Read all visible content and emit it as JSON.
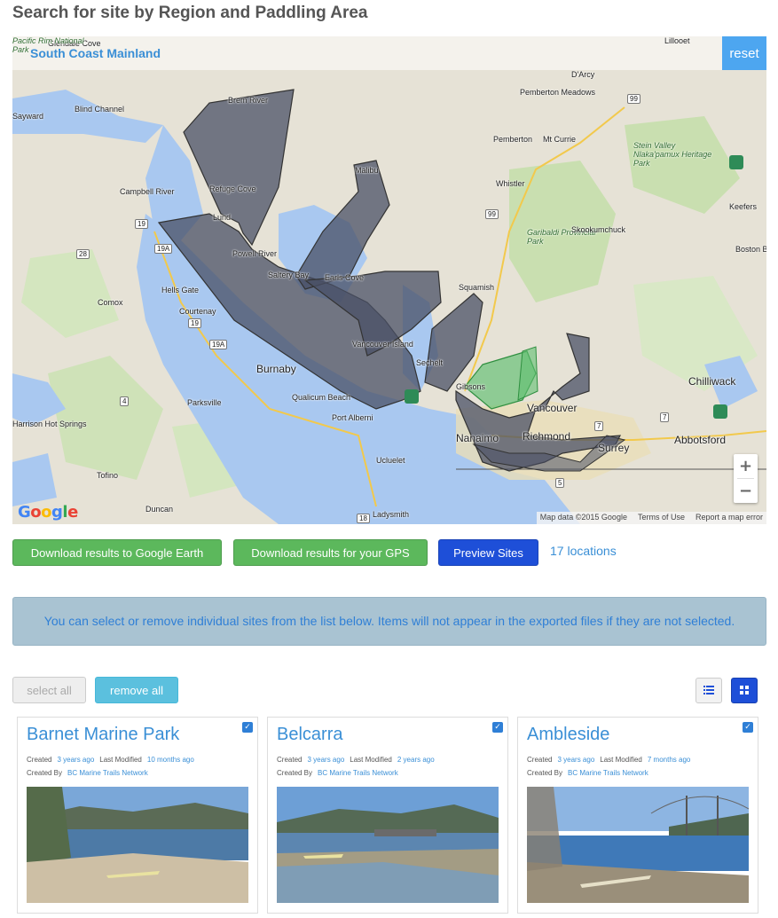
{
  "page": {
    "title": "Search for site by Region and Paddling Area"
  },
  "map": {
    "region_label": "South Coast Mainland",
    "reset_label": "reset",
    "zoom_in": "+",
    "zoom_out": "−",
    "attribution": "Map data ©2015 Google",
    "terms": "Terms of Use",
    "report": "Report a map error",
    "logo": "Google",
    "place_labels": [
      "Glendale Cove",
      "Lillooet",
      "D'Arcy",
      "Brem River",
      "Blind Channel",
      "Sayward",
      "Pemberton Meadows",
      "Pemberton",
      "Mt Currie",
      "Stein Valley Nlaka'pamux Heritage Park",
      "Malibu",
      "Refuge Cove",
      "Campbell River",
      "Whistler",
      "Keefers",
      "Lund",
      "Garibaldi Provincial Park",
      "Skookumchuck",
      "Powell River",
      "Saltery Bay",
      "Earls Cove",
      "Squamish",
      "Boston Bar",
      "Hells Gate",
      "Courtenay",
      "Comox",
      "Vancouver Island",
      "Sechelt",
      "Gibsons",
      "Vancouver",
      "Burnaby",
      "Qualicum Beach",
      "Parksville",
      "Port Alberni",
      "Nanaimo",
      "Richmond",
      "Surrey",
      "Abbotsford",
      "Chilliwack",
      "Harrison Hot Springs",
      "Tofino",
      "Ucluelet",
      "Ladysmith",
      "Duncan",
      "Pacific Rim National Park"
    ],
    "highway_labels": [
      "99",
      "99",
      "19",
      "28",
      "19A",
      "19",
      "19A",
      "4",
      "5",
      "7",
      "7",
      "18"
    ]
  },
  "actions": {
    "download_google_earth": "Download results to Google Earth",
    "download_gps": "Download results for your GPS",
    "preview_sites": "Preview Sites",
    "locations_count": "17 locations"
  },
  "info": {
    "message": "You can select or remove individual sites from the list below. Items will not appear in the exported files if they are not selected."
  },
  "list_controls": {
    "select_all": "select all",
    "remove_all": "remove all"
  },
  "colors": {
    "accent_blue": "#1e4fd8",
    "link_blue": "#3a8fd6",
    "green": "#5cb85c",
    "info": "#a9c3d2"
  },
  "cards": [
    {
      "title": "Barnet Marine Park",
      "created_label": "Created",
      "created": "3 years ago",
      "modified_label": "Last Modified",
      "modified": "10 months ago",
      "by_label": "Created By",
      "by": "BC Marine Trails Network",
      "checked": true
    },
    {
      "title": "Belcarra",
      "created_label": "Created",
      "created": "3 years ago",
      "modified_label": "Last Modified",
      "modified": "2 years ago",
      "by_label": "Created By",
      "by": "BC Marine Trails Network",
      "checked": true
    },
    {
      "title": "Ambleside",
      "created_label": "Created",
      "created": "3 years ago",
      "modified_label": "Last Modified",
      "modified": "7 months ago",
      "by_label": "Created By",
      "by": "BC Marine Trails Network",
      "checked": true
    }
  ]
}
